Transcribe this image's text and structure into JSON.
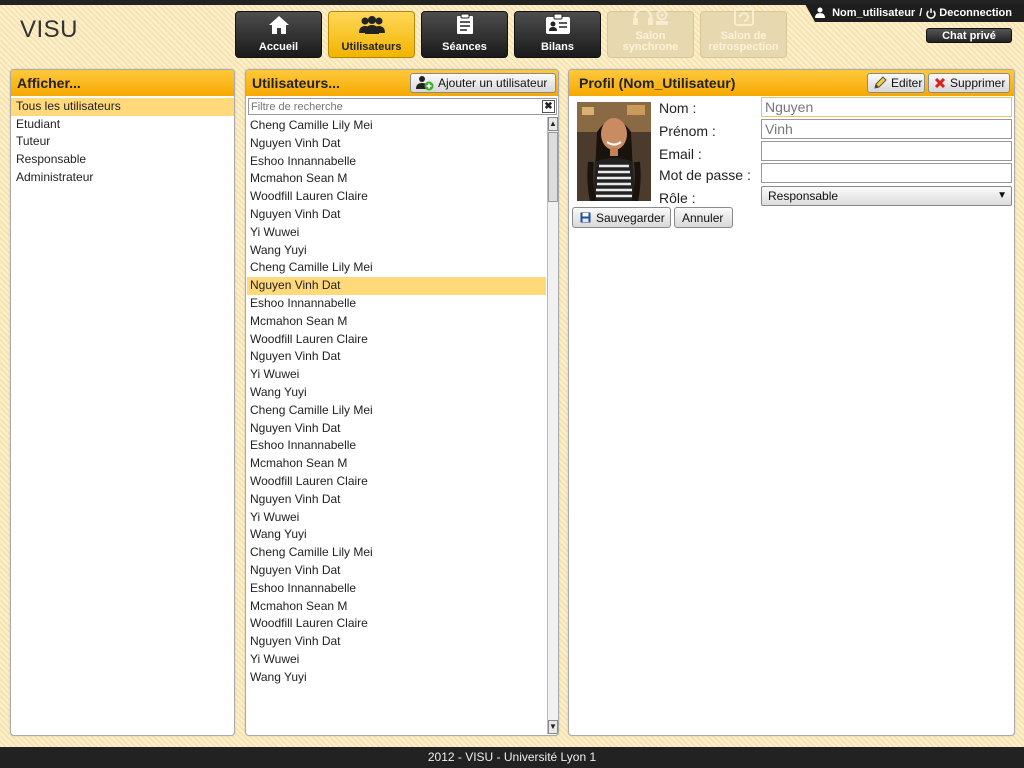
{
  "app": {
    "title": "VISU"
  },
  "user_menu": {
    "username": "Nom_utilisateur",
    "separator": "/",
    "logout": "Deconnection"
  },
  "chat": {
    "label": "Chat privé"
  },
  "nav": {
    "items": [
      {
        "label": "Accueil",
        "icon": "home-icon"
      },
      {
        "label": "Utilisateurs",
        "icon": "users-icon"
      },
      {
        "label": "Séances",
        "icon": "sessions-icon"
      },
      {
        "label": "Bilans",
        "icon": "reports-icon"
      },
      {
        "label1": "Salon",
        "label2": "synchrone",
        "icon": "sync-room-icon"
      },
      {
        "label1": "Salon de",
        "label2": "retrospection",
        "icon": "retro-room-icon"
      }
    ]
  },
  "filter_panel": {
    "title": "Afficher...",
    "items": [
      "Tous les utilisateurs",
      "Etudiant",
      "Tuteur",
      "Responsable",
      "Administrateur"
    ]
  },
  "users_panel": {
    "title": "Utilisateurs...",
    "add_label": "Ajouter un utilisateur",
    "search_placeholder": "Filtre de recherche",
    "clear_label": "✖",
    "users": [
      "Cheng Camille Lily Mei",
      "Nguyen Vinh Dat",
      "Eshoo Innannabelle",
      "Mcmahon Sean M",
      "Woodfill Lauren Claire",
      "Nguyen Vinh Dat",
      "Yi Wuwei",
      "Wang Yuyi",
      "Cheng Camille Lily Mei",
      "Nguyen Vinh Dat",
      "Eshoo Innannabelle",
      "Mcmahon Sean M",
      "Woodfill Lauren Claire",
      "Nguyen Vinh Dat",
      "Yi Wuwei",
      "Wang Yuyi",
      "Cheng Camille Lily Mei",
      "Nguyen Vinh Dat",
      "Eshoo Innannabelle",
      "Mcmahon Sean M",
      "Woodfill Lauren Claire",
      "Nguyen Vinh Dat",
      "Yi Wuwei",
      "Wang Yuyi",
      "Cheng Camille Lily Mei",
      "Nguyen Vinh Dat",
      "Eshoo Innannabelle",
      "Mcmahon Sean M",
      "Woodfill Lauren Claire",
      "Nguyen Vinh Dat",
      "Yi Wuwei",
      "Wang Yuyi"
    ]
  },
  "profile_panel": {
    "title": "Profil (Nom_Utilisateur)",
    "edit_label": "Editer",
    "delete_label": "Supprimer",
    "labels": {
      "nom": "Nom :",
      "prenom": "Prénom :",
      "email": "Email :",
      "password": "Mot de passe :",
      "role": "Rôle :"
    },
    "values": {
      "nom": "Nguyen",
      "prenom": "Vinh",
      "email": "",
      "password": ""
    },
    "role_selected": "Responsable",
    "save_label": "Sauvegarder",
    "cancel_label": "Annuler"
  },
  "footer": {
    "text": "2012 - VISU - Université Lyon 1"
  },
  "colors": {
    "accent": "#f6a800",
    "selected_row": "#ffd97a",
    "dark": "#222222"
  }
}
